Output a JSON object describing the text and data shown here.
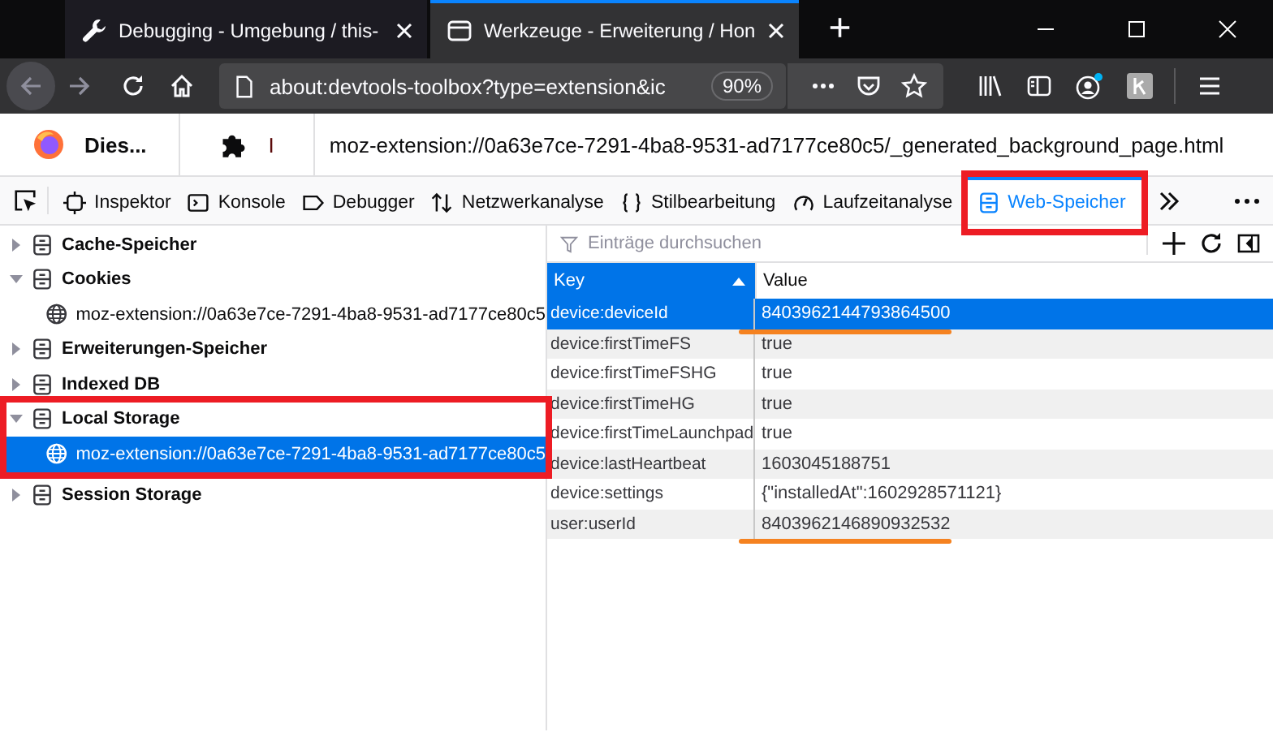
{
  "browser_tabs": [
    {
      "title": "Debugging - Umgebung / this-",
      "selected": false
    },
    {
      "title": "Werkzeuge - Erweiterung / Hon",
      "selected": true
    }
  ],
  "new_tab": "+",
  "address_bar": {
    "url": "about:devtools-toolbox?type=extension&ic",
    "zoom": "90%"
  },
  "target_bar": {
    "name": "Dies...",
    "extension_label": "I",
    "url": "moz-extension://0a63e7ce-7291-4ba8-9531-ad7177ce80c5/_generated_background_page.html"
  },
  "devtools_tabs": [
    {
      "label": "Inspektor",
      "selected": false,
      "highlighted": false
    },
    {
      "label": "Konsole",
      "selected": false,
      "highlighted": false
    },
    {
      "label": "Debugger",
      "selected": false,
      "highlighted": false
    },
    {
      "label": "Netzwerkanalyse",
      "selected": false,
      "highlighted": false
    },
    {
      "label": "Stilbearbeitung",
      "selected": false,
      "highlighted": false
    },
    {
      "label": "Laufzeitanalyse",
      "selected": false,
      "highlighted": false
    },
    {
      "label": "Web-Speicher",
      "selected": true,
      "highlighted": true
    }
  ],
  "sidebar": {
    "items": [
      {
        "label": "Cache-Speicher",
        "kind": "storage",
        "expanded": false,
        "selected": false,
        "highlighted": false
      },
      {
        "label": "Cookies",
        "kind": "storage",
        "expanded": true,
        "selected": false,
        "highlighted": false,
        "children": [
          {
            "label": "moz-extension://0a63e7ce-7291-4ba8-9531-ad7177ce80c5",
            "kind": "origin",
            "selected": false
          }
        ]
      },
      {
        "label": "Erweiterungen-Speicher",
        "kind": "storage",
        "expanded": false,
        "selected": false,
        "highlighted": false
      },
      {
        "label": "Indexed DB",
        "kind": "storage",
        "expanded": false,
        "selected": false,
        "highlighted": false
      },
      {
        "label": "Local Storage",
        "kind": "storage",
        "expanded": true,
        "selected": false,
        "highlighted": true,
        "children": [
          {
            "label": "moz-extension://0a63e7ce-7291-4ba8-9531-ad7177ce80c5",
            "kind": "origin",
            "selected": true
          }
        ]
      },
      {
        "label": "Session Storage",
        "kind": "storage",
        "expanded": false,
        "selected": false,
        "highlighted": false
      }
    ]
  },
  "filter": {
    "placeholder": "Einträge durchsuchen"
  },
  "table": {
    "columns": [
      {
        "label": "Key",
        "sorted": true
      },
      {
        "label": "Value",
        "sorted": false
      }
    ],
    "rows": [
      {
        "key": "device:deviceId",
        "value": "8403962144793864500",
        "selected": true,
        "underlined": true
      },
      {
        "key": "device:firstTimeFS",
        "value": "true",
        "selected": false,
        "underlined": false
      },
      {
        "key": "device:firstTimeFSHG",
        "value": "true",
        "selected": false,
        "underlined": false
      },
      {
        "key": "device:firstTimeHG",
        "value": "true",
        "selected": false,
        "underlined": false
      },
      {
        "key": "device:firstTimeLaunchpad",
        "value": "true",
        "selected": false,
        "underlined": false
      },
      {
        "key": "device:lastHeartbeat",
        "value": "1603045188751",
        "selected": false,
        "underlined": false
      },
      {
        "key": "device:settings",
        "value": "{\"installedAt\":1602928571121}",
        "selected": false,
        "underlined": false
      },
      {
        "key": "user:userId",
        "value": "8403962146890932532",
        "selected": false,
        "underlined": true
      }
    ]
  }
}
